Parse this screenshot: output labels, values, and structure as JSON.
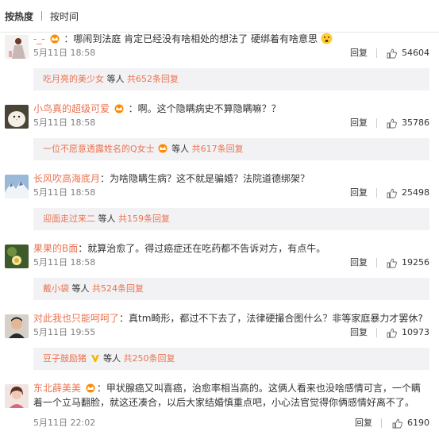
{
  "sort": {
    "hot": "按热度",
    "time": "按时间"
  },
  "comments": [
    {
      "name": "-_-",
      "text": "：哪闹到法庭 肯定已经没有啥相处的想法了 硬绑着有啥意思",
      "time": "5月11日 18:58",
      "reply": "回复",
      "likes": "54604",
      "sub_name": "吃月亮的美少女",
      "sub_mid": " 等人 ",
      "sub_count": "共652条回复"
    },
    {
      "name": "小鸟真的超级可爱",
      "text": "：啊。这个隐瞒病史不算隐瞒嘛？？",
      "time": "5月11日 18:58",
      "reply": "回复",
      "likes": "35786",
      "sub_name": "一位不愿意透露姓名的Q女士",
      "sub_mid": " 等人 ",
      "sub_count": "共617条回复"
    },
    {
      "name": "长风吹高海底月",
      "text": "：为啥隐瞒生病？这不就是骗婚？法院道德绑架？",
      "time": "5月11日 18:58",
      "reply": "回复",
      "likes": "25498",
      "sub_name": "迎面走过来二",
      "sub_mid": " 等人 ",
      "sub_count": "共159条回复"
    },
    {
      "name": "果果的B面",
      "text": "：就算治愈了。得过癌症还在吃药都不告诉对方，有点牛。",
      "time": "5月11日 18:58",
      "reply": "回复",
      "likes": "19256",
      "sub_name": "戴小袋",
      "sub_mid": " 等人 ",
      "sub_count": "共524条回复"
    },
    {
      "name": "对此我也只能呵呵了",
      "text": "：真tm畸形，都过不下去了，法律硬撮合图什么？非等家庭暴力才罢休?",
      "time": "5月11日 19:55",
      "reply": "回复",
      "likes": "10973",
      "sub_name": "豆子鼓励猪",
      "sub_mid": " 等人 ",
      "sub_count": "共250条回复"
    },
    {
      "name": "东北薛美美",
      "text": "：甲状腺癌又叫喜癌，治愈率相当高的。这俩人看来也没啥感情可言，一个瞒着一个立马翻脸，就这还凑合，以后大家结婚慎重点吧，小心法官觉得你俩感情好离不了。",
      "time": "5月11日 22:02",
      "reply": "回复",
      "likes": "6190"
    }
  ],
  "colors": {
    "name": "#eb7350",
    "sub_bg": "#f2f2f5",
    "meta": "#808080"
  },
  "icons": [
    "vip-crown-icon",
    "emoji-icon",
    "thumbs-up-icon",
    "v-badge-icon"
  ]
}
